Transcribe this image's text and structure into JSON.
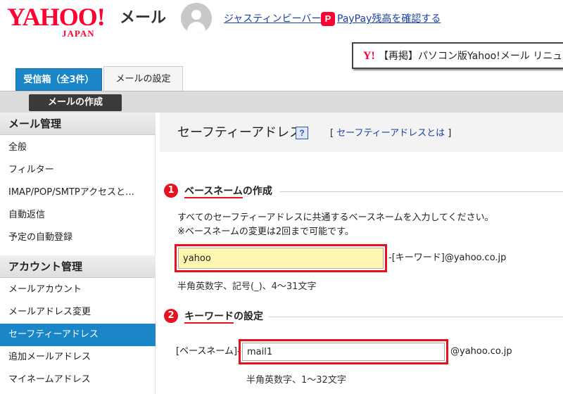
{
  "header": {
    "logo_main": "YAHOO!",
    "logo_sub": "JAPAN",
    "service_name": "メール",
    "user_name": "ジャスティンビーバー",
    "paypay_icon": "P",
    "paypay_link": "PayPay残高を確認する",
    "news_icon": "Y!",
    "news_text": "【再掲】パソコン版Yahoo!メール リニューアルのお知らせ"
  },
  "tabs": {
    "inbox": "受信箱（全3件）",
    "settings": "メールの設定"
  },
  "toolbar": {
    "compose": "メールの作成"
  },
  "sidebar": {
    "mail_management": "メール管理",
    "mail_items": [
      "全般",
      "フィルター",
      "IMAP/POP/SMTPアクセスと…",
      "自動返信",
      "予定の自動登録"
    ],
    "account_management": "アカウント管理",
    "account_items": [
      "メールアカウント",
      "メールアドレス変更",
      "セーフティーアドレス",
      "追加メールアドレス",
      "マイネームアドレス"
    ],
    "active_item": "セーフティーアドレス"
  },
  "main": {
    "title": "セーフティーアドレス",
    "help_icon": "?",
    "about_open": "[",
    "about_link": "セーフティーアドレスとは",
    "about_close": "]",
    "section1": {
      "badge": "1",
      "title_highlight": "ベースネーム",
      "title_rest": "の作成",
      "desc1": "すべてのセーフティーアドレスに共通するベースネームを入力してください。",
      "desc2": "※ベースネームの変更は2回まで可能です。",
      "value": "yahoo",
      "suffix": "-[キーワード]@yahoo.co.jp",
      "hint": "半角英数字、記号(_)、4～31文字"
    },
    "section2": {
      "badge": "2",
      "title_highlight": "キーワード",
      "title_rest": "の設定",
      "prefix": "[ベースネーム]-",
      "value": "mail1",
      "suffix": "@yahoo.co.jp",
      "hint": "半角英数字、1～32文字"
    }
  },
  "colors": {
    "brand_red": "#ff0033",
    "accent_blue": "#1a86c8",
    "link_blue": "#1a3fa6",
    "highlight_red": "#e8111e",
    "input_yellow": "#fff7b0"
  },
  "icons": {
    "avatar": "user-avatar-icon",
    "paypay": "paypay-icon",
    "help": "help-icon",
    "step": "step-number-icon"
  }
}
